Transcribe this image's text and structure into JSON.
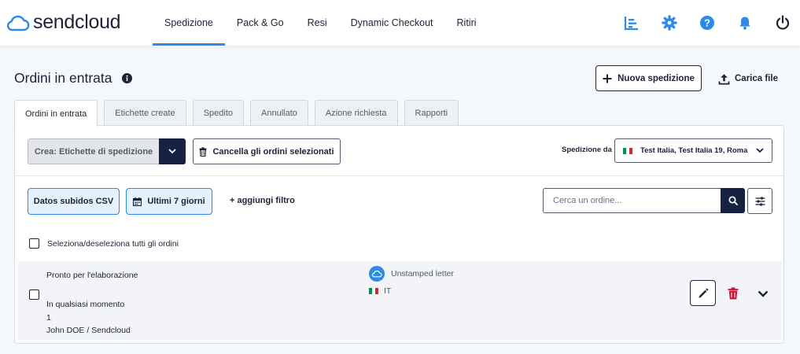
{
  "brand": {
    "name": "sendcloud",
    "color": "#2d8ae8",
    "dark": "#172243"
  },
  "nav": {
    "items": [
      {
        "label": "Spedizione",
        "active": true
      },
      {
        "label": "Pack & Go"
      },
      {
        "label": "Resi"
      },
      {
        "label": "Dynamic Checkout"
      },
      {
        "label": "Ritiri"
      }
    ],
    "icons": [
      "analytics-icon",
      "gear-icon",
      "help-icon",
      "bell-icon",
      "power-icon"
    ]
  },
  "page": {
    "title": "Ordini in entrata",
    "new_shipment": "Nuova spedizione",
    "upload_file": "Carica file"
  },
  "tabs": [
    {
      "label": "Ordini in entrata",
      "active": true
    },
    {
      "label": "Etichette create"
    },
    {
      "label": "Spedito"
    },
    {
      "label": "Annullato"
    },
    {
      "label": "Azione richiesta"
    },
    {
      "label": "Rapporti"
    }
  ],
  "toolbar": {
    "create_label": "Crea: Etichette di spedizione",
    "cancel_label": "Cancella gli ordini selezionati",
    "ship_from_label": "Spedizione da",
    "ship_from_value": "Test Italia, Test Italia 19, Roma"
  },
  "filters": {
    "csv_label": "Datos subidos CSV",
    "days_label": "Ultimi 7 giorni",
    "add_filter": "+ aggiungi filtro",
    "search_placeholder": "Cerca un ordine..."
  },
  "select_all_label": "Seleziona/deseleziona tutti gli ordini",
  "order": {
    "status": "Pronto per l'elaborazione",
    "carrier": "Unstamped letter",
    "country": "IT",
    "when": "In qualsiasi momento",
    "quantity": "1",
    "customer": "John DOE / Sendcloud"
  },
  "colors": {
    "flag_green": "#009246",
    "flag_white": "#ffffff",
    "flag_red": "#ce2b37",
    "danger": "#c8102e"
  }
}
